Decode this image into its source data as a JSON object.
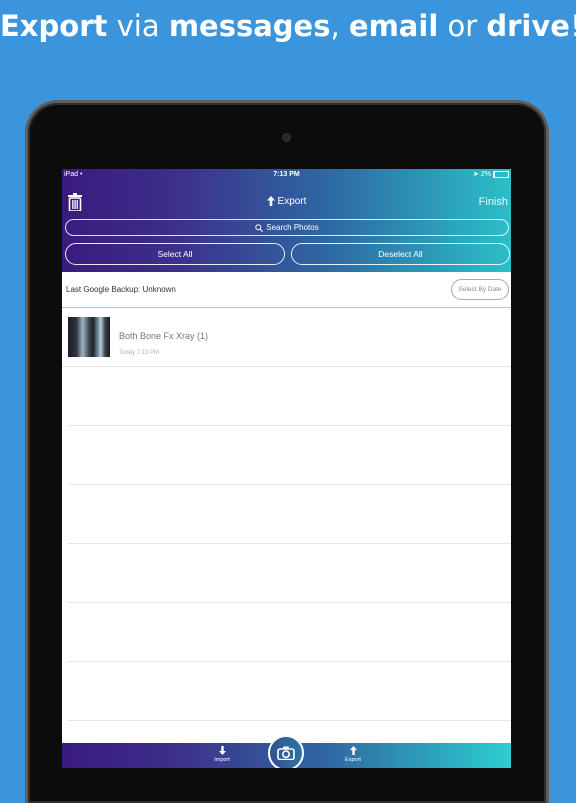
{
  "promo": {
    "w1": "Export",
    "w2": " via ",
    "w3": "messages",
    "w4": ", ",
    "w5": "email",
    "w6": " or ",
    "w7": "drive",
    "w8": "!"
  },
  "statusbar": {
    "device": "iPad",
    "time": "7:13 PM",
    "battery": "2%"
  },
  "header": {
    "title": "Export",
    "finish": "Finish",
    "search_placeholder": "Search Photos",
    "select_all": "Select All",
    "deselect_all": "Deselect All"
  },
  "backup": {
    "text": "Last Google Backup: Unknown",
    "select_by_date": "Select By Date"
  },
  "photos": [
    {
      "name": "Both Bone Fx Xray (1)",
      "date": "Today 7:13 PM"
    }
  ],
  "tabbar": {
    "import": "Import",
    "export": "Export",
    "camera_icon": "camera-icon"
  },
  "colors": {
    "background": "#3b95dc",
    "gradient_start": "#3a1a7e",
    "gradient_end": "#2bbfc8"
  }
}
